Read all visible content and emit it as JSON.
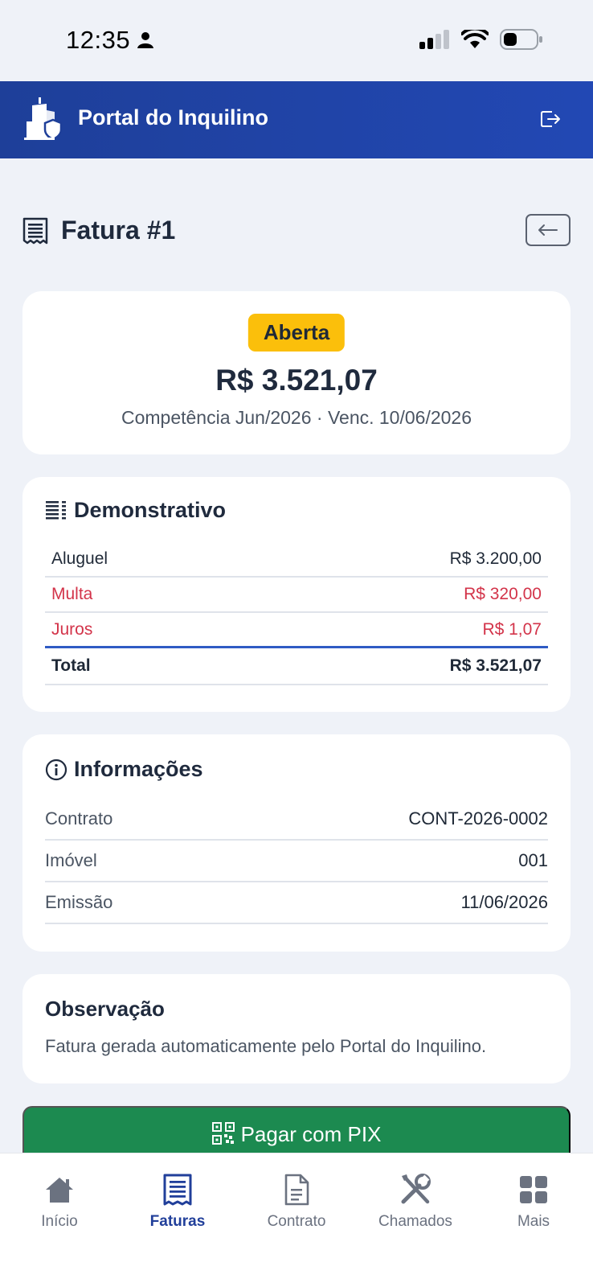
{
  "status_bar": {
    "time": "12:35"
  },
  "header": {
    "title": "Portal do Inquilino"
  },
  "page": {
    "title": "Fatura #1"
  },
  "summary": {
    "status": "Aberta",
    "amount": "R$ 3.521,07",
    "subline": "Competência Jun/2026 · Venc. 10/06/2026"
  },
  "statement": {
    "title": "Demonstrativo",
    "rows": [
      {
        "label": "Aluguel",
        "value": "R$ 3.200,00"
      },
      {
        "label": "Multa",
        "value": "R$ 320,00"
      },
      {
        "label": "Juros",
        "value": "R$ 1,07"
      }
    ],
    "total_label": "Total",
    "total_value": "R$ 3.521,07"
  },
  "info": {
    "title": "Informações",
    "rows": [
      {
        "label": "Contrato",
        "value": "CONT-2026-0002"
      },
      {
        "label": "Imóvel",
        "value": "001"
      },
      {
        "label": "Emissão",
        "value": "11/06/2026"
      }
    ]
  },
  "observation": {
    "title": "Observação",
    "text": "Fatura gerada automaticamente pelo Portal do Inquilino."
  },
  "pay_button": {
    "label": "Pagar com PIX"
  },
  "nav": {
    "items": [
      {
        "label": "Início",
        "icon": "home-icon"
      },
      {
        "label": "Faturas",
        "icon": "invoice-icon"
      },
      {
        "label": "Contrato",
        "icon": "document-icon"
      },
      {
        "label": "Chamados",
        "icon": "tools-icon"
      },
      {
        "label": "Mais",
        "icon": "grid-icon"
      }
    ],
    "active": "Faturas"
  },
  "colors": {
    "header": "#1e3f99",
    "badge": "#fbbf0b",
    "danger": "#d3344a",
    "pay": "#1c8a50",
    "nav_active": "#213f9a"
  }
}
